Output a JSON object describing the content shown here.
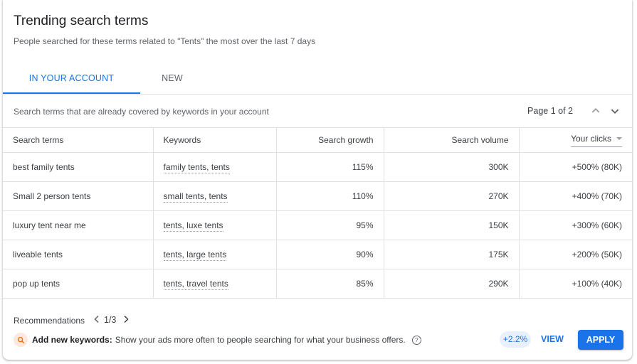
{
  "header": {
    "title": "Trending search terms",
    "subtitle": "People searched for these terms related to \"Tents\" the most over the last 7 days"
  },
  "tabs": [
    {
      "label": "IN YOUR ACCOUNT",
      "active": true
    },
    {
      "label": "NEW",
      "active": false
    }
  ],
  "infobar": {
    "text": "Search terms that are already covered by keywords in your account",
    "pager": "Page 1 of 2",
    "prev_icon": "chevron-up-icon",
    "next_icon": "chevron-down-icon"
  },
  "table": {
    "columns": [
      "Search terms",
      "Keywords",
      "Search growth",
      "Search volume",
      "Your clicks"
    ],
    "sorted_column": "Your clicks",
    "rows": [
      {
        "term": "best family tents",
        "keywords": "family tents, tents",
        "growth": "115%",
        "volume": "300K",
        "clicks": "+500% (80K)"
      },
      {
        "term": "Small 2 person tents",
        "keywords": "small tents, tents",
        "growth": "110%",
        "volume": "270K",
        "clicks": "+400% (70K)"
      },
      {
        "term": "luxury tent near me",
        "keywords": "tents, luxe tents",
        "growth": "95%",
        "volume": "150K",
        "clicks": "+300% (60K)"
      },
      {
        "term": "liveable tents",
        "keywords": "tents, large tents",
        "growth": "90%",
        "volume": "175K",
        "clicks": "+200% (50K)"
      },
      {
        "term": "pop up tents",
        "keywords": "tents, travel tents",
        "growth": "85%",
        "volume": "290K",
        "clicks": "+100% (40K)"
      }
    ]
  },
  "recommendations": {
    "label": "Recommendations",
    "position": "1/3",
    "icon": "search-icon",
    "title": "Add new keywords:",
    "description": "Show your ads more often to people searching for what your business offers.",
    "help_icon": "help-icon",
    "help_glyph": "?",
    "lift": "+2.2%",
    "view_label": "VIEW",
    "apply_label": "APPLY"
  },
  "colors": {
    "accent": "#1a73e8",
    "search_badge_bg": "#fce8dc",
    "search_badge_fg": "#e8710a",
    "lift_bg": "#e8f0fe"
  }
}
